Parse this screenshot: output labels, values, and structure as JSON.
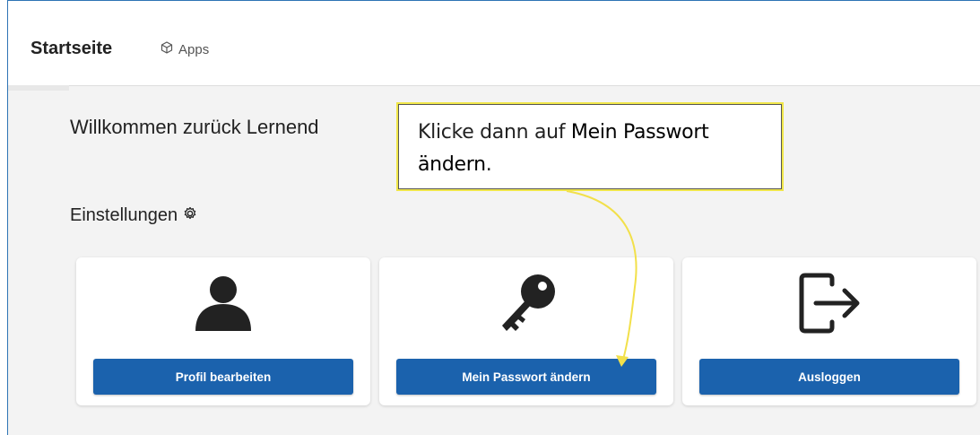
{
  "header": {
    "title": "Startseite",
    "apps_label": "Apps",
    "apps_icon": "cube-icon"
  },
  "welcome": "Willkommen zurück Lernend",
  "section": {
    "title": "Einstellungen",
    "icon": "gear-icon"
  },
  "cards": [
    {
      "icon": "person-icon",
      "button": "Profil bearbeiten"
    },
    {
      "icon": "key-icon",
      "button": "Mein Passwort ändern"
    },
    {
      "icon": "logout-icon",
      "button": "Ausloggen"
    }
  ],
  "callout": {
    "prefix": "Klicke dann auf ",
    "highlight": "Mein Passwort ändern",
    "suffix": "."
  },
  "colors": {
    "button": "#1b62ad",
    "callout_border": "#f0e64a",
    "frame_border": "#2e74b5"
  }
}
